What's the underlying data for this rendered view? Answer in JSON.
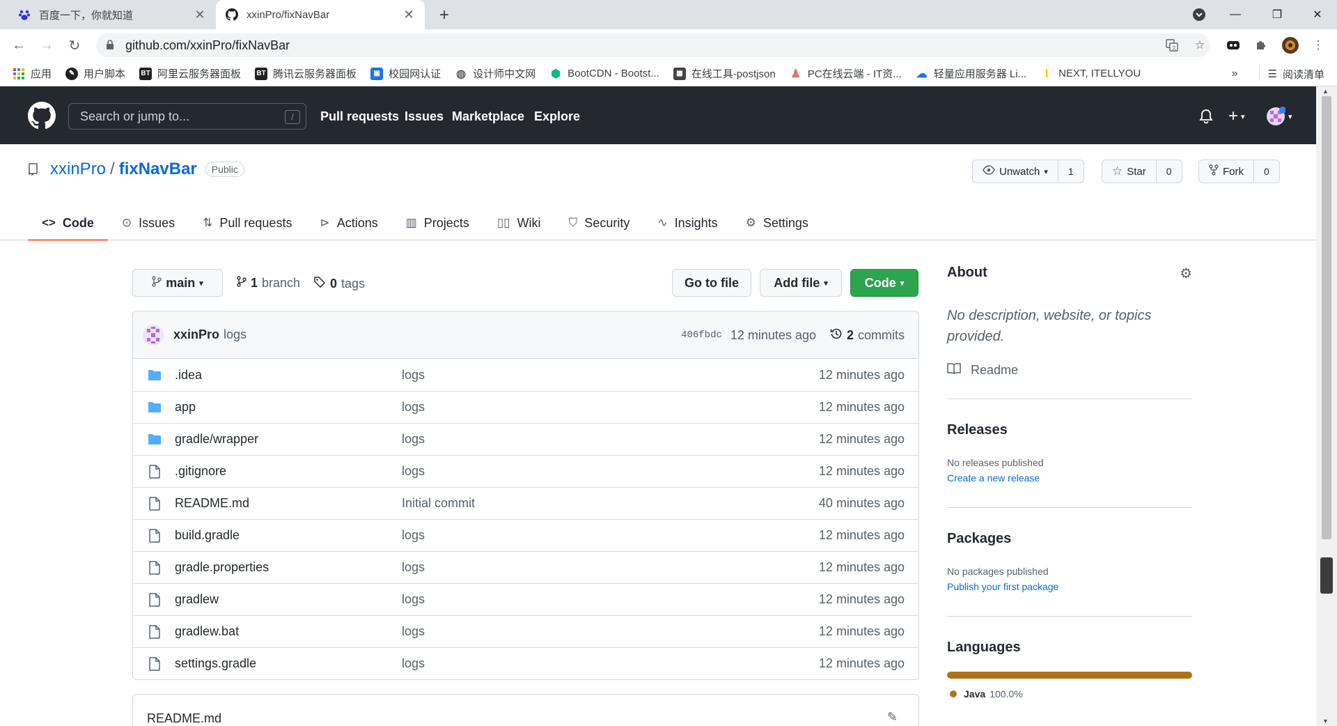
{
  "browser": {
    "tabs": [
      {
        "title": "百度一下，你就知道",
        "icon": "baidu-paw-icon"
      },
      {
        "title": "xxinPro/fixNavBar",
        "icon": "github-icon"
      }
    ],
    "url": "github.com/xxinPro/fixNavBar",
    "bookmarks": [
      {
        "label": "应用",
        "icon": "apps-grid-icon",
        "color": "#4285f4"
      },
      {
        "label": "用户脚本",
        "icon": "tampermonkey-icon",
        "color": "#202124"
      },
      {
        "label": "阿里云服务器面板",
        "icon": "bt-icon",
        "color": "#202124"
      },
      {
        "label": "腾讯云服务器面板",
        "icon": "bt-icon",
        "color": "#202124"
      },
      {
        "label": "校园网认证",
        "icon": "campus-icon",
        "color": "#1a73e8"
      },
      {
        "label": "设计师中文网",
        "icon": "globe-icon",
        "color": "#5f6368"
      },
      {
        "label": "BootCDN - Bootst...",
        "icon": "bootcdn-icon",
        "color": "#12b886"
      },
      {
        "label": "在线工具-postjson",
        "icon": "qr-icon",
        "color": "#444444"
      },
      {
        "label": "PC在线云端 - IT资...",
        "icon": "pc-cloud-icon",
        "color": "#e57373"
      },
      {
        "label": "轻量应用服务器 Li...",
        "icon": "cloud-icon",
        "color": "#1a73e8"
      },
      {
        "label": "NEXT, ITELLYOU",
        "icon": "itellyou-icon",
        "color": "#fbbc04"
      }
    ],
    "reading_list": "阅读清单"
  },
  "gh": {
    "search_placeholder": "Search or jump to...",
    "search_key": "/",
    "nav": [
      "Pull requests",
      "Issues",
      "Marketplace",
      "Explore"
    ]
  },
  "repo": {
    "owner": "xxinPro",
    "name": "fixNavBar",
    "visibility": "Public",
    "watch": {
      "label": "Unwatch",
      "count": "1"
    },
    "star": {
      "label": "Star",
      "count": "0"
    },
    "fork": {
      "label": "Fork",
      "count": "0"
    },
    "tabs": [
      {
        "label": "Code",
        "icon": "code-icon"
      },
      {
        "label": "Issues",
        "icon": "issue-icon"
      },
      {
        "label": "Pull requests",
        "icon": "pull-request-icon"
      },
      {
        "label": "Actions",
        "icon": "play-icon"
      },
      {
        "label": "Projects",
        "icon": "project-icon"
      },
      {
        "label": "Wiki",
        "icon": "book-icon"
      },
      {
        "label": "Security",
        "icon": "shield-icon"
      },
      {
        "label": "Insights",
        "icon": "graph-icon"
      },
      {
        "label": "Settings",
        "icon": "gear-icon"
      }
    ]
  },
  "main": {
    "branch": "main",
    "branch_count": "1",
    "branch_label": "branch",
    "tag_count": "0",
    "tag_label": "tags",
    "go_to_file": "Go to file",
    "add_file": "Add file",
    "code": "Code",
    "commit": {
      "author": "xxinPro",
      "message": "logs",
      "sha": "406fbdc",
      "time": "12 minutes ago",
      "commit_count": "2",
      "commit_label": "commits"
    },
    "files": [
      {
        "name": ".idea",
        "type": "dir",
        "message": "logs",
        "age": "12 minutes ago"
      },
      {
        "name": "app",
        "type": "dir",
        "message": "logs",
        "age": "12 minutes ago"
      },
      {
        "name": "gradle/wrapper",
        "type": "dir",
        "message": "logs",
        "age": "12 minutes ago"
      },
      {
        "name": ".gitignore",
        "type": "file",
        "message": "logs",
        "age": "12 minutes ago"
      },
      {
        "name": "README.md",
        "type": "file",
        "message": "Initial commit",
        "age": "40 minutes ago"
      },
      {
        "name": "build.gradle",
        "type": "file",
        "message": "logs",
        "age": "12 minutes ago"
      },
      {
        "name": "gradle.properties",
        "type": "file",
        "message": "logs",
        "age": "12 minutes ago"
      },
      {
        "name": "gradlew",
        "type": "file",
        "message": "logs",
        "age": "12 minutes ago"
      },
      {
        "name": "gradlew.bat",
        "type": "file",
        "message": "logs",
        "age": "12 minutes ago"
      },
      {
        "name": "settings.gradle",
        "type": "file",
        "message": "logs",
        "age": "12 minutes ago"
      }
    ],
    "readme_title": "README.md"
  },
  "sidebar": {
    "about": {
      "title": "About",
      "description": "No description, website, or topics provided.",
      "readme": "Readme"
    },
    "releases": {
      "title": "Releases",
      "text": "No releases published",
      "link": "Create a new release"
    },
    "packages": {
      "title": "Packages",
      "text": "No packages published",
      "link": "Publish your first package"
    },
    "languages": {
      "title": "Languages",
      "items": [
        {
          "name": "Java",
          "percent": "100.0%",
          "fraction": 1.0,
          "color": "#b07219"
        }
      ]
    }
  },
  "colors": {
    "accent": "#0969da",
    "green": "#2da44e",
    "header": "#24292f",
    "tab_underline": "#fd8c73"
  }
}
